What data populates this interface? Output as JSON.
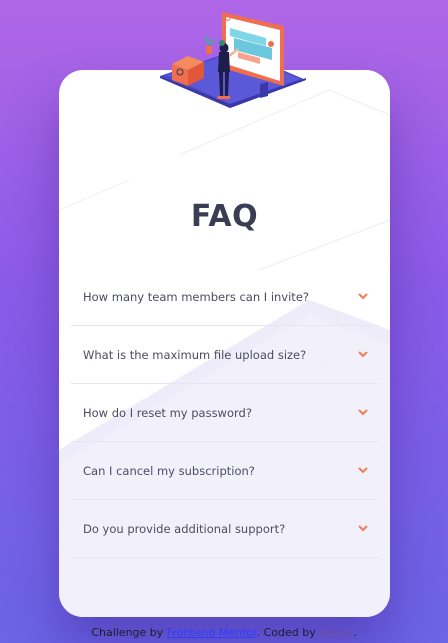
{
  "faq": {
    "title": "FAQ",
    "items": [
      {
        "question": "How many team members can I invite?"
      },
      {
        "question": "What is the maximum file upload size?"
      },
      {
        "question": "How do I reset my password?"
      },
      {
        "question": "Can I cancel my subscription?"
      },
      {
        "question": "Do you provide additional support?"
      }
    ]
  },
  "attribution": {
    "prefix": "Challenge by ",
    "link1": "Frontend Mentor",
    "middle": ". Coded by ",
    "link2": "brkcln",
    "suffix": "."
  },
  "colors": {
    "background_top": "#b066e6",
    "background_bottom": "#6a64e6",
    "card": "#ffffff",
    "title": "#3b3d55",
    "question": "#4b4c61",
    "chevron": "#f47b56",
    "divider": "#e6e6ef"
  },
  "icons": {
    "chevron": "chevron-down-icon",
    "hero": "woman-at-monitor-illustration"
  }
}
